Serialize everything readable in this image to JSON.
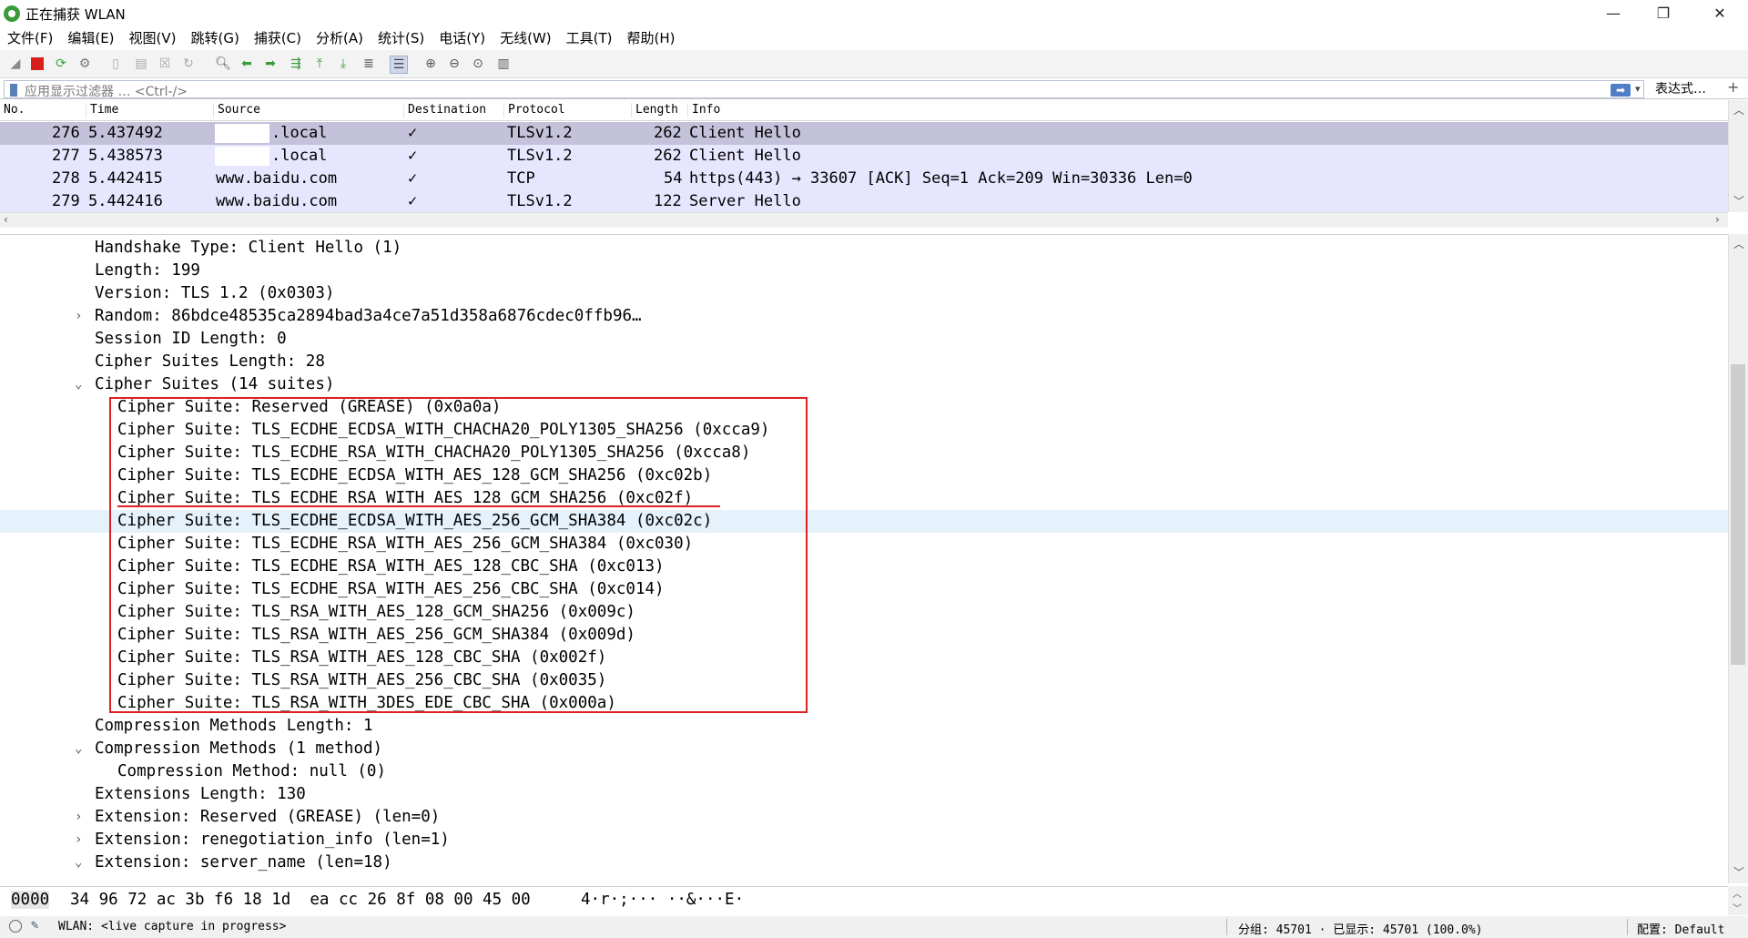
{
  "window": {
    "title": "正在捕获 WLAN",
    "minimize": "—",
    "maximize": "❐",
    "close": "✕"
  },
  "menu": [
    "文件(F)",
    "编辑(E)",
    "视图(V)",
    "跳转(G)",
    "捕获(C)",
    "分析(A)",
    "统计(S)",
    "电话(Y)",
    "无线(W)",
    "工具(T)",
    "帮助(H)"
  ],
  "toolbar_icons": [
    "shark-fin-icon",
    "stop-capture-icon",
    "restart-capture-icon",
    "capture-options-icon",
    "open-file-icon",
    "save-file-icon",
    "close-file-icon",
    "reload-icon",
    "find-packet-icon",
    "go-back-icon",
    "go-forward-icon",
    "go-to-packet-icon",
    "go-first-icon",
    "go-last-icon",
    "auto-scroll-icon",
    "colorize-icon",
    "zoom-in-icon",
    "zoom-out-icon",
    "zoom-normal-icon",
    "resize-columns-icon"
  ],
  "filter": {
    "placeholder": "应用显示过滤器 … <Ctrl-/>",
    "expression_button": "表达式…",
    "plus": "+"
  },
  "packet_list": {
    "columns": [
      "No.",
      "Time",
      "Source",
      "Destination",
      "Protocol",
      "Length",
      "Info"
    ],
    "rows": [
      {
        "no": "276",
        "time": "5.437492",
        "source": ".local",
        "destination": "✓",
        "protocol": "TLSv1.2",
        "length": "262",
        "info": "Client Hello",
        "selected": true
      },
      {
        "no": "277",
        "time": "5.438573",
        "source": ".local",
        "destination": "✓",
        "protocol": "TLSv1.2",
        "length": "262",
        "info": "Client Hello",
        "selected": false
      },
      {
        "no": "278",
        "time": "5.442415",
        "source": "www.baidu.com",
        "destination": "✓",
        "protocol": "TCP",
        "length": "54",
        "info": "https(443) → 33607 [ACK] Seq=1 Ack=209 Win=30336 Len=0",
        "selected": false
      },
      {
        "no": "279",
        "time": "5.442416",
        "source": "www.baidu.com",
        "destination": "✓",
        "protocol": "TLSv1.2",
        "length": "122",
        "info": "Server Hello",
        "selected": false
      }
    ]
  },
  "details": [
    {
      "text": "Handshake Type: Client Hello (1)",
      "indent": 0,
      "toggle": ""
    },
    {
      "text": "Length: 199",
      "indent": 0,
      "toggle": ""
    },
    {
      "text": "Version: TLS 1.2 (0x0303)",
      "indent": 0,
      "toggle": ""
    },
    {
      "text": "Random: 86bdce48535ca2894bad3a4ce7a51d358a6876cdec0ffb96…",
      "indent": 0,
      "toggle": ">"
    },
    {
      "text": "Session ID Length: 0",
      "indent": 0,
      "toggle": ""
    },
    {
      "text": "Cipher Suites Length: 28",
      "indent": 0,
      "toggle": ""
    },
    {
      "text": "Cipher Suites (14 suites)",
      "indent": 0,
      "toggle": "v"
    },
    {
      "text": "Cipher Suite: Reserved (GREASE) (0x0a0a)",
      "indent": 1,
      "toggle": ""
    },
    {
      "text": "Cipher Suite: TLS_ECDHE_ECDSA_WITH_CHACHA20_POLY1305_SHA256 (0xcca9)",
      "indent": 1,
      "toggle": ""
    },
    {
      "text": "Cipher Suite: TLS_ECDHE_RSA_WITH_CHACHA20_POLY1305_SHA256 (0xcca8)",
      "indent": 1,
      "toggle": ""
    },
    {
      "text": "Cipher Suite: TLS_ECDHE_ECDSA_WITH_AES_128_GCM_SHA256 (0xc02b)",
      "indent": 1,
      "toggle": ""
    },
    {
      "text": "Cipher Suite: TLS_ECDHE_RSA_WITH_AES_128_GCM_SHA256 (0xc02f)",
      "indent": 1,
      "toggle": ""
    },
    {
      "text": "Cipher Suite: TLS_ECDHE_ECDSA_WITH_AES_256_GCM_SHA384 (0xc02c)",
      "indent": 1,
      "toggle": "",
      "highlight": true
    },
    {
      "text": "Cipher Suite: TLS_ECDHE_RSA_WITH_AES_256_GCM_SHA384 (0xc030)",
      "indent": 1,
      "toggle": ""
    },
    {
      "text": "Cipher Suite: TLS_ECDHE_RSA_WITH_AES_128_CBC_SHA (0xc013)",
      "indent": 1,
      "toggle": ""
    },
    {
      "text": "Cipher Suite: TLS_ECDHE_RSA_WITH_AES_256_CBC_SHA (0xc014)",
      "indent": 1,
      "toggle": ""
    },
    {
      "text": "Cipher Suite: TLS_RSA_WITH_AES_128_GCM_SHA256 (0x009c)",
      "indent": 1,
      "toggle": ""
    },
    {
      "text": "Cipher Suite: TLS_RSA_WITH_AES_256_GCM_SHA384 (0x009d)",
      "indent": 1,
      "toggle": ""
    },
    {
      "text": "Cipher Suite: TLS_RSA_WITH_AES_128_CBC_SHA (0x002f)",
      "indent": 1,
      "toggle": ""
    },
    {
      "text": "Cipher Suite: TLS_RSA_WITH_AES_256_CBC_SHA (0x0035)",
      "indent": 1,
      "toggle": ""
    },
    {
      "text": "Cipher Suite: TLS_RSA_WITH_3DES_EDE_CBC_SHA (0x000a)",
      "indent": 1,
      "toggle": ""
    },
    {
      "text": "Compression Methods Length: 1",
      "indent": 0,
      "toggle": ""
    },
    {
      "text": "Compression Methods (1 method)",
      "indent": 0,
      "toggle": "v"
    },
    {
      "text": "Compression Method: null (0)",
      "indent": 1,
      "toggle": ""
    },
    {
      "text": "Extensions Length: 130",
      "indent": 0,
      "toggle": ""
    },
    {
      "text": "Extension: Reserved (GREASE) (len=0)",
      "indent": 0,
      "toggle": ">"
    },
    {
      "text": "Extension: renegotiation_info (len=1)",
      "indent": 0,
      "toggle": ">"
    },
    {
      "text": "Extension: server_name (len=18)",
      "indent": 0,
      "toggle": "v"
    }
  ],
  "bytes": {
    "offset": "0000",
    "hex": "34 96 72 ac 3b f6 18 1d  ea cc 26 8f 08 00 45 00",
    "ascii": "4·r·;··· ··&···E·"
  },
  "status": {
    "interface": "WLAN: <live capture in progress>",
    "packets": "分组: 45701 · 已显示: 45701 (100.0%)",
    "profile": "配置: Default"
  }
}
